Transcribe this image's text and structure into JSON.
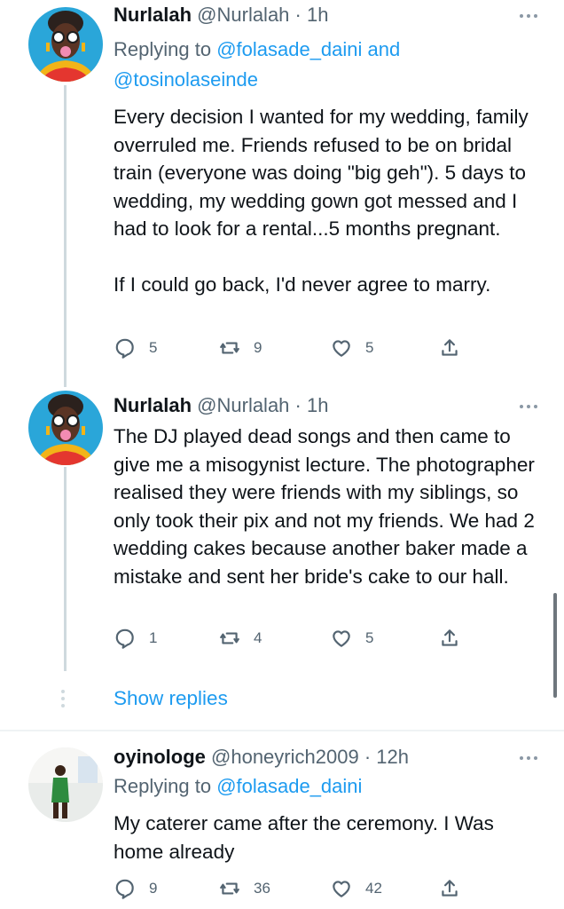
{
  "tweets": [
    {
      "name": "Nurlalah",
      "handle": "@Nurlalah",
      "dot": "·",
      "time": "1h",
      "replying_prefix": "Replying to ",
      "replying_line1_mention": "@folasade_daini",
      "replying_and": " and",
      "replying_line2_mention": "@tosinolaseinde",
      "text": "Every decision I wanted for my wedding, family overruled me. Friends refused to be on bridal train (everyone was doing \"big geh\"). 5 days to wedding, my wedding gown got messed and I had to look for a rental...5 months pregnant.\n\nIf I could go back, I'd never agree to marry.",
      "replies": "5",
      "retweets": "9",
      "likes": "5"
    },
    {
      "name": "Nurlalah",
      "handle": "@Nurlalah",
      "dot": "·",
      "time": "1h",
      "text": "The DJ played dead songs and then came to give me a misogynist lecture. The photographer realised they were friends with my siblings, so only took their pix and not my friends. We had 2 wedding cakes because another baker made a mistake and sent her bride's cake to our hall.",
      "replies": "1",
      "retweets": "4",
      "likes": "5"
    },
    {
      "name": "oyinologe",
      "handle": "@honeyrich2009",
      "dot": "·",
      "time": "12h",
      "replying_prefix": "Replying to ",
      "replying_line1_mention": "@folasade_daini",
      "text": "My caterer came after the ceremony. I Was home already",
      "replies": "9",
      "retweets": "36",
      "likes": "42"
    }
  ],
  "show_replies": "Show replies",
  "icons": {
    "reply": "reply-icon",
    "retweet": "retweet-icon",
    "like": "heart-icon",
    "share": "share-icon",
    "more": "more-icon"
  },
  "colors": {
    "link": "#1d9bf0",
    "secondary": "#536471",
    "text": "#0f1419",
    "thread_line": "#cfd9de"
  }
}
